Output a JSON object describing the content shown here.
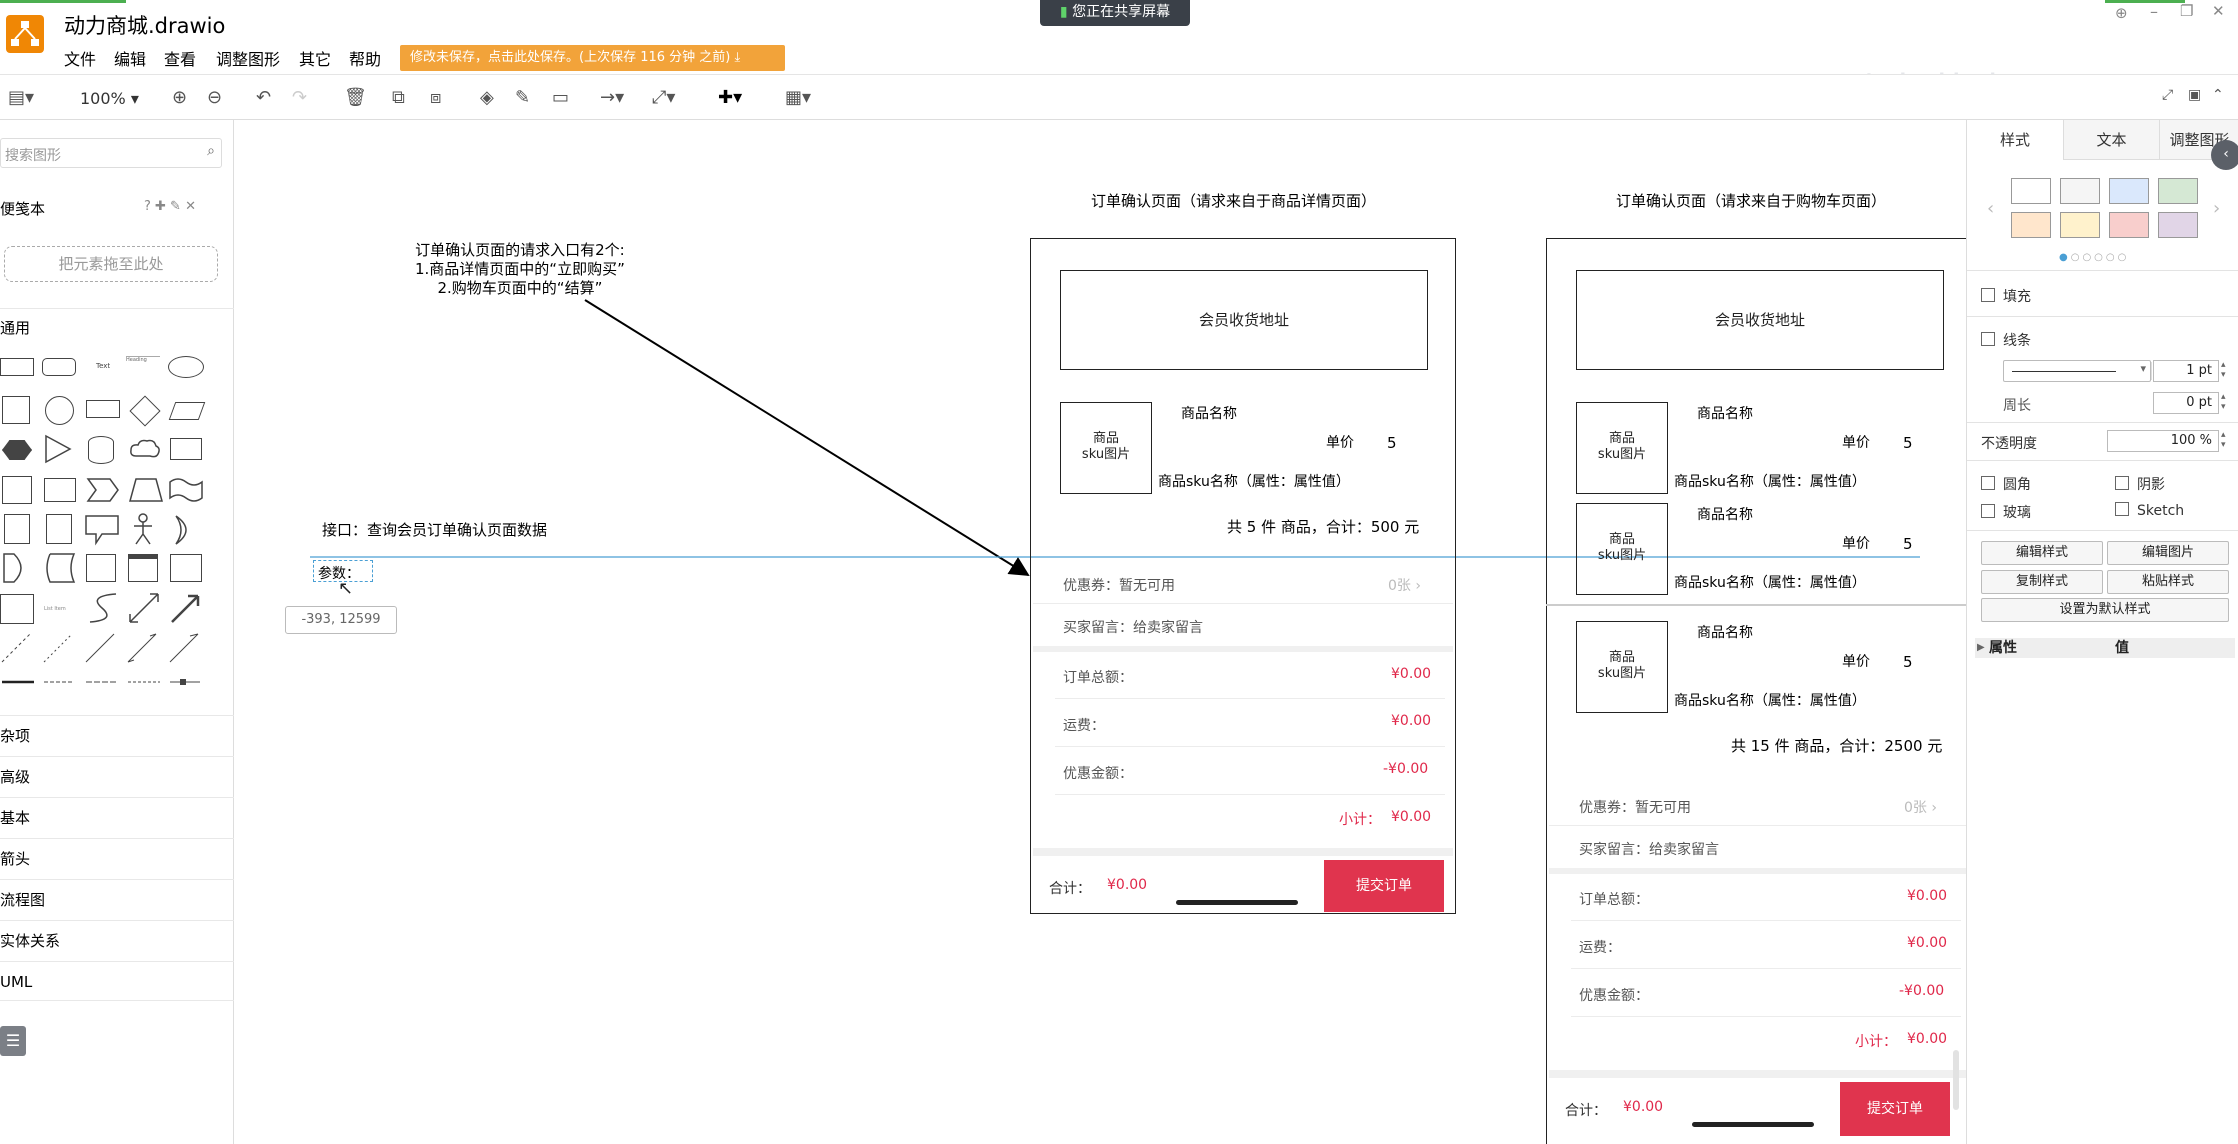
{
  "app": {
    "title": "动力商城.drawio",
    "menus": [
      "文件",
      "编辑",
      "查看",
      "调整图形",
      "其它",
      "帮助"
    ],
    "save_warning": "修改未保存，点击此处保存。(上次保存 116 分钟 之前)",
    "share_badge": "您正在共享屏幕",
    "watermark": "动力节点"
  },
  "toolbar": {
    "zoom": "100%"
  },
  "left_panel": {
    "search_placeholder": "搜索图形",
    "scratchpad": "便笺本",
    "scratch_drop": "把元素拖至此处",
    "general": "通用",
    "categories": [
      "杂项",
      "高级",
      "基本",
      "箭头",
      "流程图",
      "实体关系",
      "UML"
    ]
  },
  "right_panel": {
    "tabs": [
      "样式",
      "文本",
      "调整图形"
    ],
    "fill": "填充",
    "line": "线条",
    "line_width": "1 pt",
    "perimeter": "周长",
    "perimeter_value": "0 pt",
    "opacity": "不透明度",
    "opacity_value": "100 %",
    "rounded": "圆角",
    "shadow": "阴影",
    "glass": "玻璃",
    "sketch": "Sketch",
    "edit_style": "编辑样式",
    "edit_image": "编辑图片",
    "copy_style": "复制样式",
    "paste_style": "粘贴样式",
    "set_default": "设置为默认样式",
    "prop_header": "属性",
    "value_header": "值",
    "swatch_colors": [
      "#ffffff",
      "#f5f5f5",
      "#dae8fc",
      "#d5e8d4",
      "#ffe6cc",
      "#fff2cc",
      "#f8cecc",
      "#e1d5e7"
    ]
  },
  "canvas": {
    "note": [
      "订单确认页面的请求入口有2个:",
      "1.商品详情页面中的“立即购买”",
      "2.购物车页面中的“结算”"
    ],
    "api": "接口：查询会员订单确认页面数据",
    "params": "参数：",
    "coord_tip": "-393, 12599",
    "page1": {
      "title": "订单确认页面（请求来自于商品详情页面）",
      "address": "会员收货地址",
      "item_img": "商品\nsku图片",
      "item_name": "商品名称",
      "price_label": "单价",
      "price": "5",
      "sku": "商品sku名称（属性：属性值）",
      "summary": "共 5 件 商品，合计：500 元",
      "coupon": "优惠券：暂无可用",
      "coupon_count": "0张",
      "message": "买家留言：给卖家留言",
      "total_label": "订单总额：",
      "total": "¥0.00",
      "freight_label": "运费：",
      "freight": "¥0.00",
      "discount_label": "优惠金额：",
      "discount": "-¥0.00",
      "subtotal_label": "小计：",
      "subtotal": "¥0.00",
      "footer_label": "合计：",
      "footer_amount": "¥0.00",
      "submit": "提交订单"
    },
    "page2": {
      "title": "订单确认页面（请求来自于购物车页面）",
      "address": "会员收货地址",
      "summary": "共 15 件 商品，合计：2500 元",
      "coupon": "优惠券：暂无可用",
      "coupon_count": "0张",
      "message": "买家留言：给卖家留言",
      "total_label": "订单总额：",
      "total": "¥0.00",
      "freight_label": "运费：",
      "freight": "¥0.00",
      "discount_label": "优惠金额：",
      "discount": "-¥0.00",
      "subtotal_label": "小计：",
      "subtotal": "¥0.00",
      "footer_label": "合计：",
      "footer_amount": "¥0.00",
      "submit": "提交订单"
    }
  }
}
